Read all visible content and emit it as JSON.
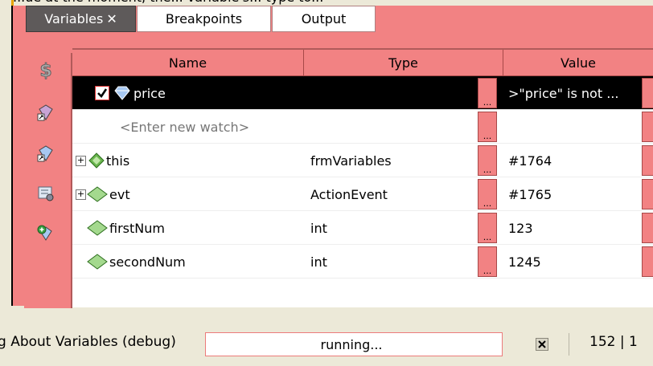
{
  "top_strip_text": "...ue at the moment, the... variable's... type to...",
  "tabs": [
    {
      "label": "Variables",
      "close": "✕",
      "active": true
    },
    {
      "label": "Breakpoints",
      "active": false
    },
    {
      "label": "Output",
      "active": false
    }
  ],
  "columns": {
    "name": "Name",
    "type": "Type",
    "value": "Value"
  },
  "watch_row": {
    "name": "price",
    "checked": true,
    "type": "",
    "value": ">\"price\" is not ..."
  },
  "new_watch_placeholder": "<Enter new watch>",
  "variables": [
    {
      "name": "this",
      "type": "frmVariables",
      "value": "#1764",
      "expandable": true
    },
    {
      "name": "evt",
      "type": "ActionEvent",
      "value": "#1765",
      "expandable": true
    },
    {
      "name": "firstNum",
      "type": "int",
      "value": "123",
      "expandable": false
    },
    {
      "name": "secondNum",
      "type": "int",
      "value": "1245",
      "expandable": false
    }
  ],
  "ellipsis": "...",
  "status": {
    "label": "g About Variables (debug)",
    "progress_text": "running...",
    "position": "152 | 1"
  },
  "colors": {
    "panel": "#f28283",
    "selection": "#000000",
    "accent": "#5e5a5a"
  }
}
